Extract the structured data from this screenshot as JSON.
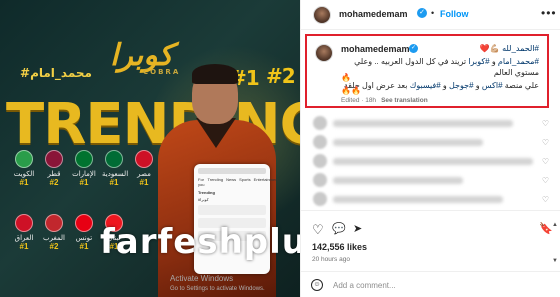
{
  "image": {
    "hashtag_name": "#محمد_امام",
    "trending": "TRENDING",
    "cobra_title": "كوبرا",
    "cobra_sub": "COBRA",
    "rank1": "#1",
    "rank2": "#2",
    "flags_row1": [
      {
        "name": "الكويت",
        "rank": "#1",
        "color": "#2a9d4a"
      },
      {
        "name": "قطر",
        "rank": "#2",
        "color": "#8a1538"
      },
      {
        "name": "الإمارات",
        "rank": "#1",
        "color": "#00732f"
      },
      {
        "name": "السعودية",
        "rank": "#1",
        "color": "#006c35"
      },
      {
        "name": "مصر",
        "rank": "#1",
        "color": "#ce1126"
      }
    ],
    "flags_row2": [
      {
        "name": "العراق",
        "rank": "#1",
        "color": "#ce1126"
      },
      {
        "name": "المغرب",
        "rank": "#2",
        "color": "#c1272d"
      },
      {
        "name": "تونس",
        "rank": "#1",
        "color": "#e70013"
      },
      {
        "name": "لبنان",
        "rank": "#1",
        "color": "#ee161f"
      }
    ],
    "phone_tabs": [
      "For you",
      "Trending",
      "News",
      "Sports",
      "Entertainment"
    ],
    "phone_header": "Trending",
    "phone_item": "#كوبرا",
    "watermark": "farfesh",
    "watermark_domain": "plus.com"
  },
  "header": {
    "username": "mohamedemam",
    "verified": "✓",
    "separator": "•",
    "follow_label": "Follow",
    "more": "•••"
  },
  "caption": {
    "username": "mohamedemam",
    "verified": "✓",
    "line1_prefix": "💪🏼❤️",
    "line1_tag": "#الحمد_لله",
    "line2_tag1": "#محمد_امام",
    "line2_mid": " و ",
    "line2_tag2": "#كوبرا",
    "line2_text": " تريند في كل الدول العربيه .. وعلي مستوي العالم",
    "fire1": "🔥",
    "line3_text1": "علي منصة ",
    "line3_tag1": "#اكس",
    "line3_mid1": " و ",
    "line3_tag2": "#جوجل",
    "line3_mid2": " و ",
    "line3_tag3": "#فيسبوك",
    "line3_text2": " بعد عرض اول حلقة",
    "fire2": "🔥🔥",
    "edited": "Edited · 18h",
    "see_translation": "See translation"
  },
  "comments_blurred": [
    {
      "line_width": 180
    },
    {
      "line_width": 150
    },
    {
      "line_width": 200
    },
    {
      "line_width": 130
    },
    {
      "line_width": 170
    }
  ],
  "actions": {
    "like_icon": "♡",
    "comment_icon": "💬",
    "share_icon": "➤",
    "save_icon": "🔖"
  },
  "likes": "142,556 likes",
  "time": "20 hours ago",
  "comment_box": {
    "emoji_icon": "☺",
    "placeholder": "Add a comment..."
  },
  "windows": {
    "activate": "Activate Windows",
    "activate_sub": "Go to Settings to activate Windows."
  },
  "scroll": {
    "up": "▲",
    "down": "▼"
  }
}
